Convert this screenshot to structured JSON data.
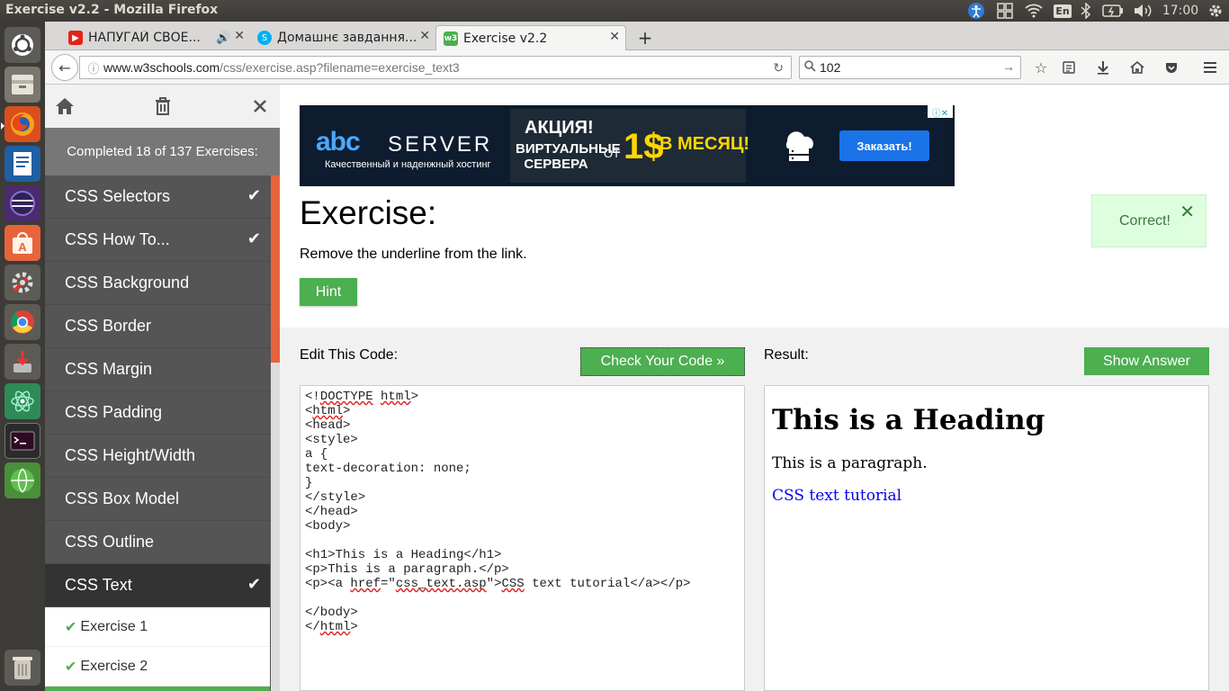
{
  "os": {
    "window_title": "Exercise v2.2 - Mozilla Firefox",
    "keyboard_layout": "En",
    "clock": "17:00"
  },
  "tabs": [
    {
      "label": "НАПУГАЙ СВОЕ...",
      "icon": "youtube-icon"
    },
    {
      "label": "Домашнє завдання...",
      "icon": "skype-icon"
    },
    {
      "label": "Exercise v2.2",
      "icon": "w3schools-icon"
    }
  ],
  "urlbar": {
    "domain": "www.w3schools.com",
    "path": "/css/exercise.asp?filename=exercise_text3"
  },
  "search": {
    "value": "102"
  },
  "sidebar": {
    "progress": "Completed 18 of 137 Exercises:",
    "items": [
      {
        "label": "CSS Selectors",
        "check": "✔"
      },
      {
        "label": "CSS How To...",
        "check": "✔"
      },
      {
        "label": "CSS Background",
        "check": ""
      },
      {
        "label": "CSS Border",
        "check": ""
      },
      {
        "label": "CSS Margin",
        "check": ""
      },
      {
        "label": "CSS Padding",
        "check": ""
      },
      {
        "label": "CSS Height/Width",
        "check": ""
      },
      {
        "label": "CSS Box Model",
        "check": ""
      },
      {
        "label": "CSS Outline",
        "check": ""
      },
      {
        "label": "CSS Text",
        "check": "✔"
      }
    ],
    "subitems": [
      {
        "label": "Exercise 1",
        "check": "✔"
      },
      {
        "label": "Exercise 2",
        "check": "✔"
      }
    ]
  },
  "ad": {
    "logo": "abc",
    "brand": "SERVER",
    "slogan": "Качественный и наденжный хостинг",
    "promo_title": "АКЦИЯ!",
    "promo_sub": "ВИРТУАЛЬНЫЕ СЕРВЕРА",
    "promo_from": "ОТ",
    "promo_price": "1$",
    "promo_period": "В МЕСЯЦ!",
    "order_button": "Заказать!"
  },
  "exercise": {
    "title": "Exercise:",
    "instruction": "Remove the underline from the link.",
    "hint_label": "Hint",
    "feedback": "Correct!"
  },
  "editor": {
    "label": "Edit This Code:",
    "check_button": "Check Your Code »",
    "code_lines": [
      "<!DOCTYPE html>",
      "<html>",
      "<head>",
      "<style>",
      "a {",
      "text-decoration: none;",
      "}",
      "</style>",
      "</head>",
      "<body>",
      "",
      "<h1>This is a Heading</h1>",
      "<p>This is a paragraph.</p>",
      "<p><a href=\"css_text.asp\">CSS text tutorial</a></p>",
      "",
      "</body>",
      "</html>"
    ]
  },
  "result": {
    "label": "Result:",
    "answer_button": "Show Answer",
    "heading": "This is a Heading",
    "paragraph": "This is a paragraph.",
    "link": "CSS text tutorial"
  },
  "colors": {
    "accent_green": "#4caf50",
    "sidebar_bg": "#555555",
    "scroll_accent": "#e7643b"
  }
}
